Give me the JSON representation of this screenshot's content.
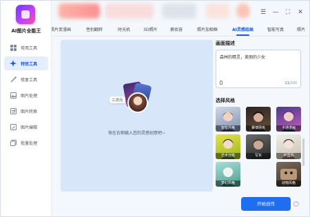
{
  "app": {
    "name": "AI图片全能王"
  },
  "sidebar": {
    "items": [
      {
        "label": "常用工具",
        "icon": "grid-icon",
        "active": false
      },
      {
        "label": "特效工具",
        "icon": "sparkle-icon",
        "active": true
      },
      {
        "label": "修复工具",
        "icon": "wand-icon",
        "active": false
      },
      {
        "label": "图片处理",
        "icon": "image-icon",
        "active": false
      },
      {
        "label": "图片转换",
        "icon": "convert-icon",
        "active": false
      },
      {
        "label": "图片编辑",
        "icon": "edit-icon",
        "active": false
      },
      {
        "label": "批量处理",
        "icon": "batch-icon",
        "active": false
      }
    ]
  },
  "window_controls": {
    "menu": "☰",
    "minimize": "—",
    "maximize": "⛶",
    "close": "✕"
  },
  "tabs": [
    {
      "label": "照片变漫画",
      "active": false
    },
    {
      "label": "性别翻转",
      "active": false
    },
    {
      "label": "时光机",
      "active": false
    },
    {
      "label": "3D照片",
      "active": false
    },
    {
      "label": "换妆容",
      "active": false
    },
    {
      "label": "照片加相框",
      "active": false
    },
    {
      "label": "AI灵感绘画",
      "active": true
    },
    {
      "label": "智能写真",
      "active": false
    },
    {
      "label": "照片",
      "active": false
    }
  ],
  "canvas": {
    "tag": "二次元",
    "hint": "快在右侧输入您的灵感创意吧~"
  },
  "panel": {
    "desc_title": "画面描述",
    "desc_text": "森林的精灵，美丽的少女",
    "char_count": "11",
    "char_max": "/200",
    "style_title": "选择风格",
    "styles": [
      {
        "label": "",
        "name": "style-anime-icon"
      },
      {
        "label": "",
        "name": "style-portrait-icon"
      },
      {
        "label": "",
        "name": "style-fantasy-icon"
      },
      {
        "label": "智能风格",
        "name": "style-smart-icon"
      },
      {
        "label": "赛博朋克",
        "name": "style-cyberpunk-icon"
      },
      {
        "label": "卡通漫画",
        "name": "style-cartoon-icon"
      },
      {
        "label": "艺术创意",
        "name": "style-art-icon"
      },
      {
        "label": "写实",
        "name": "style-realistic-icon"
      },
      {
        "label": "中国风",
        "name": "style-chinese-icon"
      },
      {
        "label": "梦幻风格",
        "name": "style-dreamy-icon"
      },
      {
        "label": "",
        "name": "style-empty"
      },
      {
        "label": "动物风格",
        "name": "style-animal-icon"
      }
    ]
  },
  "actions": {
    "start": "开始创作",
    "help": "?"
  }
}
